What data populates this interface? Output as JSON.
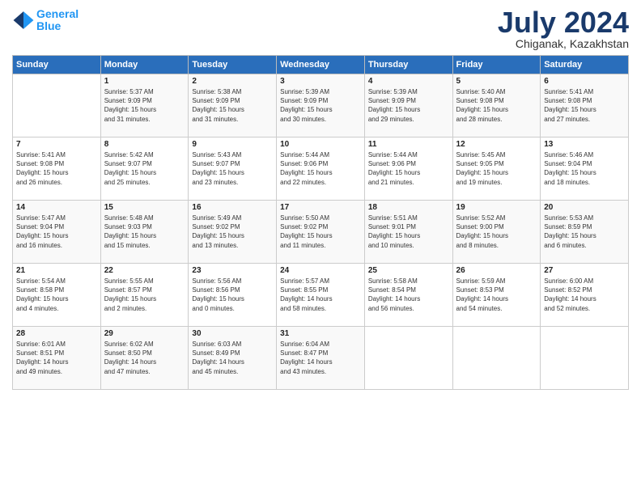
{
  "logo": {
    "line1": "General",
    "line2": "Blue"
  },
  "title": "July 2024",
  "location": "Chiganak, Kazakhstan",
  "days_of_week": [
    "Sunday",
    "Monday",
    "Tuesday",
    "Wednesday",
    "Thursday",
    "Friday",
    "Saturday"
  ],
  "weeks": [
    [
      {
        "day": "",
        "info": ""
      },
      {
        "day": "1",
        "info": "Sunrise: 5:37 AM\nSunset: 9:09 PM\nDaylight: 15 hours\nand 31 minutes."
      },
      {
        "day": "2",
        "info": "Sunrise: 5:38 AM\nSunset: 9:09 PM\nDaylight: 15 hours\nand 31 minutes."
      },
      {
        "day": "3",
        "info": "Sunrise: 5:39 AM\nSunset: 9:09 PM\nDaylight: 15 hours\nand 30 minutes."
      },
      {
        "day": "4",
        "info": "Sunrise: 5:39 AM\nSunset: 9:09 PM\nDaylight: 15 hours\nand 29 minutes."
      },
      {
        "day": "5",
        "info": "Sunrise: 5:40 AM\nSunset: 9:08 PM\nDaylight: 15 hours\nand 28 minutes."
      },
      {
        "day": "6",
        "info": "Sunrise: 5:41 AM\nSunset: 9:08 PM\nDaylight: 15 hours\nand 27 minutes."
      }
    ],
    [
      {
        "day": "7",
        "info": "Sunrise: 5:41 AM\nSunset: 9:08 PM\nDaylight: 15 hours\nand 26 minutes."
      },
      {
        "day": "8",
        "info": "Sunrise: 5:42 AM\nSunset: 9:07 PM\nDaylight: 15 hours\nand 25 minutes."
      },
      {
        "day": "9",
        "info": "Sunrise: 5:43 AM\nSunset: 9:07 PM\nDaylight: 15 hours\nand 23 minutes."
      },
      {
        "day": "10",
        "info": "Sunrise: 5:44 AM\nSunset: 9:06 PM\nDaylight: 15 hours\nand 22 minutes."
      },
      {
        "day": "11",
        "info": "Sunrise: 5:44 AM\nSunset: 9:06 PM\nDaylight: 15 hours\nand 21 minutes."
      },
      {
        "day": "12",
        "info": "Sunrise: 5:45 AM\nSunset: 9:05 PM\nDaylight: 15 hours\nand 19 minutes."
      },
      {
        "day": "13",
        "info": "Sunrise: 5:46 AM\nSunset: 9:04 PM\nDaylight: 15 hours\nand 18 minutes."
      }
    ],
    [
      {
        "day": "14",
        "info": "Sunrise: 5:47 AM\nSunset: 9:04 PM\nDaylight: 15 hours\nand 16 minutes."
      },
      {
        "day": "15",
        "info": "Sunrise: 5:48 AM\nSunset: 9:03 PM\nDaylight: 15 hours\nand 15 minutes."
      },
      {
        "day": "16",
        "info": "Sunrise: 5:49 AM\nSunset: 9:02 PM\nDaylight: 15 hours\nand 13 minutes."
      },
      {
        "day": "17",
        "info": "Sunrise: 5:50 AM\nSunset: 9:02 PM\nDaylight: 15 hours\nand 11 minutes."
      },
      {
        "day": "18",
        "info": "Sunrise: 5:51 AM\nSunset: 9:01 PM\nDaylight: 15 hours\nand 10 minutes."
      },
      {
        "day": "19",
        "info": "Sunrise: 5:52 AM\nSunset: 9:00 PM\nDaylight: 15 hours\nand 8 minutes."
      },
      {
        "day": "20",
        "info": "Sunrise: 5:53 AM\nSunset: 8:59 PM\nDaylight: 15 hours\nand 6 minutes."
      }
    ],
    [
      {
        "day": "21",
        "info": "Sunrise: 5:54 AM\nSunset: 8:58 PM\nDaylight: 15 hours\nand 4 minutes."
      },
      {
        "day": "22",
        "info": "Sunrise: 5:55 AM\nSunset: 8:57 PM\nDaylight: 15 hours\nand 2 minutes."
      },
      {
        "day": "23",
        "info": "Sunrise: 5:56 AM\nSunset: 8:56 PM\nDaylight: 15 hours\nand 0 minutes."
      },
      {
        "day": "24",
        "info": "Sunrise: 5:57 AM\nSunset: 8:55 PM\nDaylight: 14 hours\nand 58 minutes."
      },
      {
        "day": "25",
        "info": "Sunrise: 5:58 AM\nSunset: 8:54 PM\nDaylight: 14 hours\nand 56 minutes."
      },
      {
        "day": "26",
        "info": "Sunrise: 5:59 AM\nSunset: 8:53 PM\nDaylight: 14 hours\nand 54 minutes."
      },
      {
        "day": "27",
        "info": "Sunrise: 6:00 AM\nSunset: 8:52 PM\nDaylight: 14 hours\nand 52 minutes."
      }
    ],
    [
      {
        "day": "28",
        "info": "Sunrise: 6:01 AM\nSunset: 8:51 PM\nDaylight: 14 hours\nand 49 minutes."
      },
      {
        "day": "29",
        "info": "Sunrise: 6:02 AM\nSunset: 8:50 PM\nDaylight: 14 hours\nand 47 minutes."
      },
      {
        "day": "30",
        "info": "Sunrise: 6:03 AM\nSunset: 8:49 PM\nDaylight: 14 hours\nand 45 minutes."
      },
      {
        "day": "31",
        "info": "Sunrise: 6:04 AM\nSunset: 8:47 PM\nDaylight: 14 hours\nand 43 minutes."
      },
      {
        "day": "",
        "info": ""
      },
      {
        "day": "",
        "info": ""
      },
      {
        "day": "",
        "info": ""
      }
    ]
  ]
}
